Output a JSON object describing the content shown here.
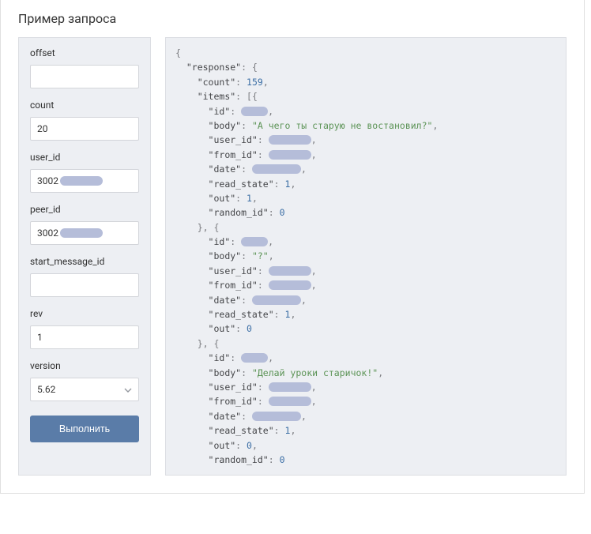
{
  "header": {
    "title": "Пример запроса"
  },
  "sidebar": {
    "params": [
      {
        "label": "offset",
        "value": ""
      },
      {
        "label": "count",
        "value": "20"
      },
      {
        "label": "user_id",
        "value": "3002"
      },
      {
        "label": "peer_id",
        "value": "3002"
      },
      {
        "label": "start_message_id",
        "value": ""
      },
      {
        "label": "rev",
        "value": "1"
      }
    ],
    "version_label": "version",
    "version_value": "5.62",
    "run_label": "Выполнить"
  },
  "response": {
    "count": 159,
    "items": [
      {
        "id": "REDACTED",
        "body": "А чего ты старую не востановил?",
        "user_id": "REDACTED",
        "from_id": "REDACTED",
        "date": "REDACTED",
        "read_state": 1,
        "out": 1,
        "random_id": 0
      },
      {
        "id": "REDACTED",
        "body": "?",
        "user_id": "REDACTED",
        "from_id": "REDACTED",
        "date": "REDACTED",
        "read_state": 1,
        "out": 0
      },
      {
        "id": "REDACTED",
        "body": "Делай уроки старичок!",
        "user_id": "REDACTED",
        "from_id": "REDACTED",
        "date": "REDACTED",
        "read_state": 1,
        "out": 0,
        "random_id": 0
      }
    ]
  }
}
